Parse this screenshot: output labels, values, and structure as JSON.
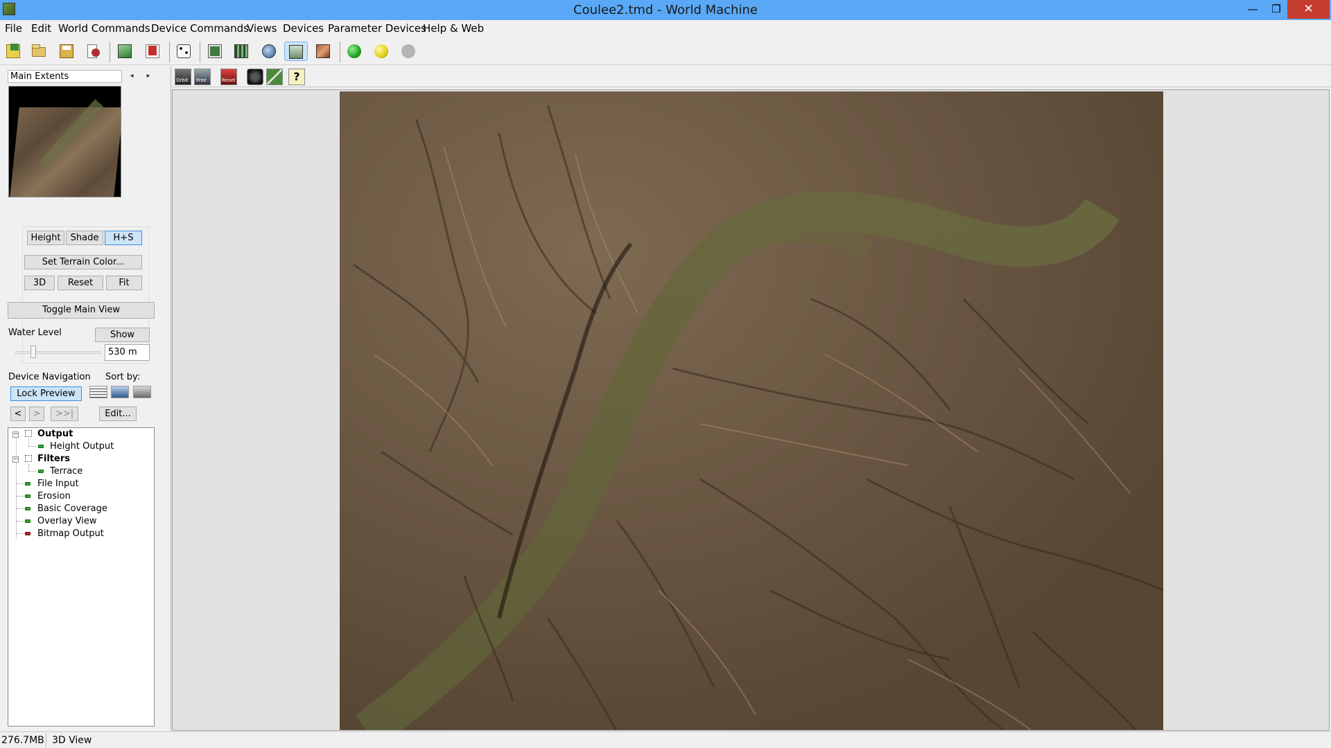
{
  "window": {
    "title": "Coulee2.tmd - World Machine",
    "minimize": "—",
    "maximize": "❐",
    "close": "✕"
  },
  "menu": [
    "File",
    "Edit",
    "World Commands",
    "Device Commands",
    "Views",
    "Devices",
    "Parameter Devices",
    "Help & Web"
  ],
  "toolbar": {
    "icons": [
      "new-world-icon",
      "open-icon",
      "save-icon",
      "wizard-icon",
      "terrain-build-icon",
      "terrain-export-icon",
      "random-seed-icon",
      "layout-view-icon",
      "device-view-icon",
      "3d-view-icon",
      "overlay-view-icon",
      "texture-view-icon",
      "build-green-icon",
      "build-yellow-icon",
      "build-stop-icon"
    ],
    "selected": "overlay-view-icon",
    "colors": {
      "green": "#22a322",
      "yellow": "#e0d218",
      "gray": "#b4b4b4"
    }
  },
  "left": {
    "extents_label": "Main Extents",
    "prev_arrow": "◂",
    "next_arrow": "▸",
    "view_modes": [
      "Height",
      "Shade",
      "H+S"
    ],
    "view_mode_selected": "H+S",
    "set_terrain_color": "Set Terrain Color...",
    "btn_3d": "3D",
    "btn_reset": "Reset",
    "btn_fit": "Fit",
    "toggle_main_view": "Toggle Main View",
    "water_level_label": "Water Level",
    "water_show": "Show",
    "water_value": "530 m",
    "device_nav_label": "Device Navigation",
    "sort_by_label": "Sort by:",
    "lock_preview": "Lock Preview",
    "nav_prev": "<",
    "nav_next": ">",
    "nav_last": ">>|",
    "edit_btn": "Edit..."
  },
  "tree": [
    {
      "label": "Output",
      "kind": "group",
      "bold": true
    },
    {
      "label": "Height Output",
      "kind": "child",
      "led": "green"
    },
    {
      "label": "Filters",
      "kind": "group",
      "bold": true
    },
    {
      "label": "Terrace",
      "kind": "child",
      "led": "green"
    },
    {
      "label": "File Input",
      "kind": "root",
      "led": "green"
    },
    {
      "label": "Erosion",
      "kind": "root",
      "led": "green"
    },
    {
      "label": "Basic Coverage",
      "kind": "root",
      "led": "green"
    },
    {
      "label": "Overlay View",
      "kind": "root",
      "led": "green"
    },
    {
      "label": "Bitmap Output",
      "kind": "root",
      "led": "red"
    }
  ],
  "view_toolbar": {
    "icons": [
      "orbit-icon",
      "free-camera-icon",
      "reset-camera-icon",
      "snapshot-camera-icon",
      "draw-line-icon",
      "help-icon"
    ],
    "orbit_label": "Orbit",
    "free_label": "Free",
    "reset_label": "Reset"
  },
  "status": {
    "memory": "276.7MB",
    "view": "3D View"
  }
}
